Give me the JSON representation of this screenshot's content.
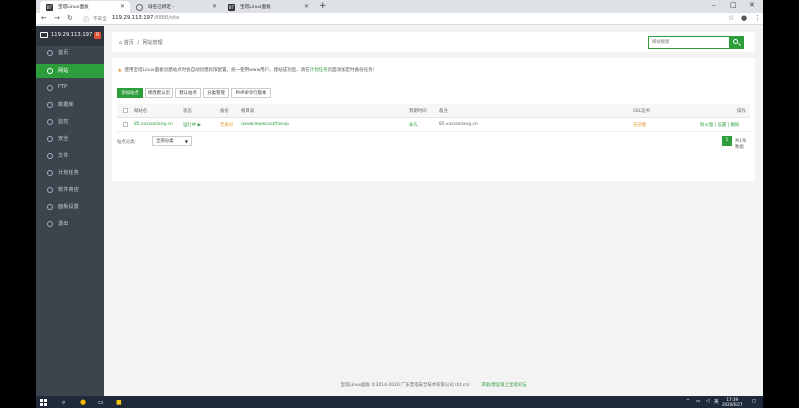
{
  "browser": {
    "tabs": [
      {
        "title": "宝塔Linux面板",
        "icon": "bt-logo-icon",
        "active": true
      },
      {
        "title": "域名已绑定 -",
        "icon": "globe-icon",
        "active": false
      },
      {
        "title": "宝塔Linux面板",
        "icon": "bt-logo-icon",
        "active": false
      }
    ],
    "new_tab": "+",
    "address_info": "不安全",
    "url_host": "119.29.113.197",
    "url_rest": ":8888/site",
    "window_controls": [
      "–",
      "□",
      "✕"
    ]
  },
  "sidebar": {
    "server_ip": "119.29.113.197",
    "badge": "0",
    "items": [
      {
        "label": "首页",
        "icon": "home-icon",
        "active": false
      },
      {
        "label": "网站",
        "icon": "globe-icon",
        "active": true
      },
      {
        "label": "FTP",
        "icon": "ftp-icon",
        "active": false
      },
      {
        "label": "数据库",
        "icon": "database-icon",
        "active": false
      },
      {
        "label": "监控",
        "icon": "monitor-icon",
        "active": false
      },
      {
        "label": "安全",
        "icon": "shield-icon",
        "active": false
      },
      {
        "label": "文件",
        "icon": "folder-icon",
        "active": false
      },
      {
        "label": "计划任务",
        "icon": "clock-icon",
        "active": false
      },
      {
        "label": "软件商店",
        "icon": "store-icon",
        "active": false
      },
      {
        "label": "面板设置",
        "icon": "gear-icon",
        "active": false
      },
      {
        "label": "退出",
        "icon": "logout-icon",
        "active": false
      }
    ]
  },
  "breadcrumb": {
    "home": "首页",
    "separator": "/",
    "current": "网站管理"
  },
  "search": {
    "placeholder": "网站搜索"
  },
  "notice": {
    "text": "使用宝塔Linux面板创建站点时会自动创建权限配置，统一使用www用户。建站成功后，请在",
    "link": "计划任务",
    "suffix": "页面添加定时备份任务!"
  },
  "toolbar": {
    "buttons": [
      "添加站点",
      "修改默认页",
      "默认站点",
      "分类管理",
      "PHP命令行版本"
    ]
  },
  "table": {
    "headers": [
      "网站名",
      "状态",
      "备份",
      "根目录",
      "到期时间",
      "备注",
      "SSL证书",
      "操作"
    ],
    "rows": [
      {
        "name": "85.xxxiaoliang.cn",
        "status": "运行中 ▶",
        "backup": "无备份",
        "root": "/www/wwwroot/fasvip",
        "expire": "永久",
        "remark": "85.xxxiaoliang.cn",
        "ssl": "未部署",
        "actions": "防火墙 | 设置 | 删除"
      }
    ]
  },
  "pagination": {
    "category_label": "站点分类:",
    "category_value": "全部分类",
    "current_page": "1",
    "total": "共1条数据"
  },
  "footer": {
    "copyright": "宝塔Linux面板 ©2014-2020 广东堡塔安全技术有限公司 (bt.cn)",
    "link": "求助/建议请上宝塔论坛"
  },
  "taskbar": {
    "time": "17:39",
    "date": "2020/6/27",
    "ime": "英"
  }
}
